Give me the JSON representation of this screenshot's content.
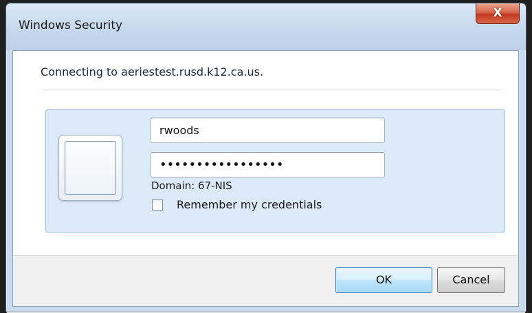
{
  "window": {
    "title": "Windows Security",
    "close_label": "X"
  },
  "message": {
    "connecting": "Connecting to aeriestest.rusd.k12.ca.us."
  },
  "credentials": {
    "username_value": "rwoods",
    "password_value": "•••••••••••••••••",
    "domain_text": "Domain: 67-NIS",
    "remember_label": "Remember my credentials",
    "remember_checked": false
  },
  "buttons": {
    "ok_label": "OK",
    "cancel_label": "Cancel"
  },
  "colors": {
    "titlebar": "#c4d7ec",
    "panel": "#dce9f7",
    "close_button": "#c2391e",
    "default_button": "#bee6fd"
  },
  "icons": {
    "user_tile": "user-tile-icon",
    "close": "close-icon"
  }
}
